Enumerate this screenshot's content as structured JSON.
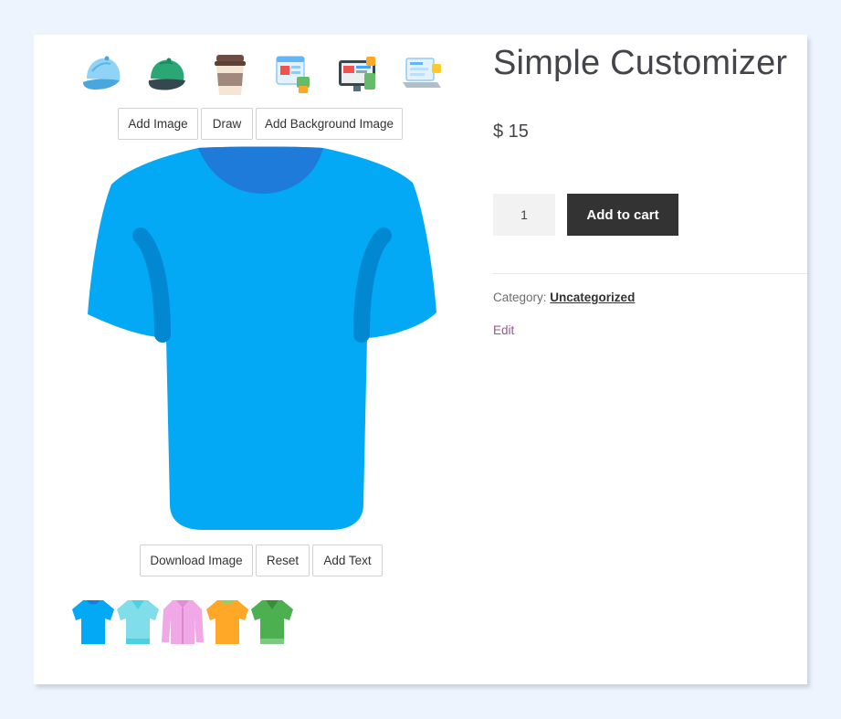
{
  "product": {
    "title": "Simple Customizer",
    "price": "$ 15",
    "quantity": "1",
    "add_to_cart_label": "Add to cart",
    "category_label": "Category:",
    "category_value": "Uncategorized",
    "edit_label": "Edit"
  },
  "product_icons": [
    "cap-light-blue-icon",
    "cap-green-icon",
    "coffee-cup-icon",
    "web-design-icon",
    "monitor-design-icon",
    "laptop-icon"
  ],
  "toolbar_top": {
    "add_image": "Add Image",
    "draw": "Draw",
    "add_background_image": "Add Background Image"
  },
  "toolbar_bottom": {
    "download_image": "Download Image",
    "reset": "Reset",
    "add_text": "Add Text"
  },
  "canvas": {
    "shirt_color": "#03a9f4",
    "collar_color": "#1e7bd9",
    "seam_color": "#0288d1"
  },
  "variants": [
    {
      "name": "blue-tshirt-icon",
      "color": "#03a9f4"
    },
    {
      "name": "teal-polo-icon",
      "color": "#80deea"
    },
    {
      "name": "pink-shirt-icon",
      "color": "#f0a8e6"
    },
    {
      "name": "orange-tshirt-icon",
      "color": "#ffa726"
    },
    {
      "name": "green-polo-icon",
      "color": "#4caf50"
    }
  ]
}
